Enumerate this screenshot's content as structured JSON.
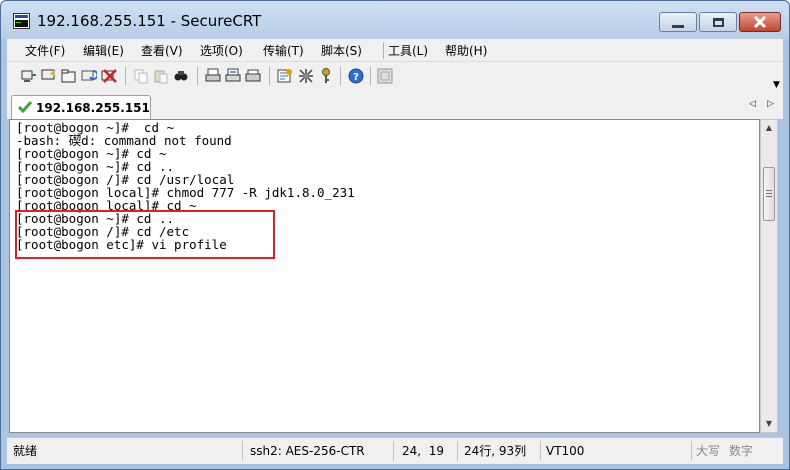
{
  "window": {
    "title": "192.168.255.151 - SecureCRT"
  },
  "menu": [
    "文件(F)",
    "编辑(E)",
    "查看(V)",
    "选项(O)",
    "传输(T)",
    "脚本(S)",
    "工具(L)",
    "帮助(H)"
  ],
  "toolbar": {
    "icons": [
      "connect-icon",
      "quick-connect-icon",
      "connect-in-tab-icon",
      "reconnect-icon",
      "disconnect-icon",
      "copy-icon",
      "paste-icon",
      "find-icon",
      "print-icon",
      "print-selection-icon",
      "print-setup-icon",
      "session-options-icon",
      "global-options-icon",
      "key-icon",
      "help-icon",
      "unknown-icon"
    ]
  },
  "tab": {
    "label": "192.168.255.151",
    "status_color": "#3aa63a"
  },
  "terminal": {
    "lines": [
      "[root@bogon ~]#  cd ~",
      "-bash: 碶d: command not found",
      "[root@bogon ~]# cd ~",
      "[root@bogon ~]# cd ..",
      "[root@bogon /]# cd /usr/local",
      "[root@bogon local]# chmod 777 -R jdk1.8.0_231",
      "[root@bogon local]# cd ~",
      "[root@bogon ~]# cd ..",
      "[root@bogon /]# cd /etc",
      "[root@bogon etc]# vi profile"
    ],
    "highlight_color": "#e02020"
  },
  "status": {
    "ready": "就绪",
    "cipher": "ssh2: AES-256-CTR",
    "cursor": "24,  19",
    "size": "24行, 93列",
    "term_type": "VT100",
    "caps": "大写",
    "num": "数字"
  }
}
